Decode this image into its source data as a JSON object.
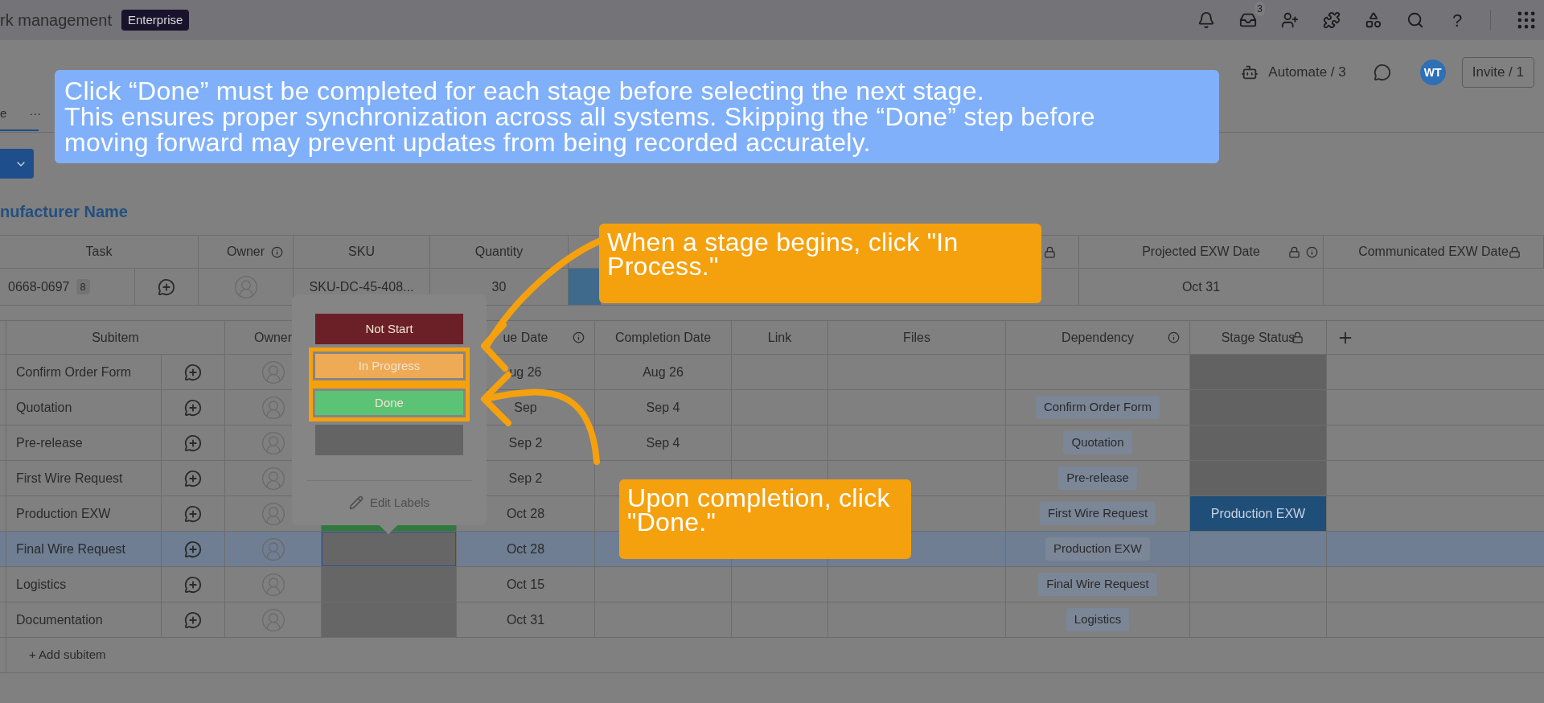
{
  "topbar": {
    "product": "rk management",
    "plan": "Enterprise",
    "inbox_count": "3",
    "help": "?"
  },
  "board": {
    "tab": "e",
    "more": "···",
    "automate": "Automate / 3",
    "avatar": "WT",
    "invite": "Invite / 1"
  },
  "group_title": "nufacturer Name",
  "main_columns": [
    {
      "label": "Task"
    },
    {
      "label": "Owner",
      "info": true
    },
    {
      "label": "SKU"
    },
    {
      "label": "Quantity"
    },
    {
      "lock": true
    },
    {
      "label": "Projected EXW Date",
      "info": true,
      "lock": true
    },
    {
      "label": "Communicated EXW Date",
      "lock": true
    }
  ],
  "main_row": {
    "task": "0668-0697",
    "count": "8",
    "sku": "SKU-DC-45-408...",
    "quantity": "30",
    "status": {
      "color": "#3f6a8c"
    },
    "projected": "Oct 31"
  },
  "sub_columns": [
    {
      "label": "Subitem"
    },
    {
      "label": "Owner"
    },
    {
      "label": "ue Date",
      "info": true
    },
    {
      "label": "Completion Date"
    },
    {
      "label": "Link"
    },
    {
      "label": "Files"
    },
    {
      "label": "Dependency",
      "info": true
    },
    {
      "label": "Stage Status",
      "lock": true
    }
  ],
  "subitems": [
    {
      "name": "Confirm Order Form",
      "selected": false,
      "due": "ug 26",
      "completion": "Aug 26",
      "stage": {
        "color": "#626262"
      }
    },
    {
      "name": "Quotation",
      "selected": false,
      "due": "Sep",
      "completion": "Sep 4",
      "dependency": "Confirm Order Form",
      "stage": {
        "color": "#626262"
      }
    },
    {
      "name": "Pre-release",
      "selected": false,
      "due": "Sep 2",
      "completion": "Sep 4",
      "dependency": "Quotation",
      "stage": {
        "color": "#626262"
      }
    },
    {
      "name": "First Wire Request",
      "selected": false,
      "due": "Sep 2",
      "dependency": "Pre-release",
      "stage": {
        "color": "#626262"
      }
    },
    {
      "name": "Production EXW",
      "selected": false,
      "due": "Oct 28",
      "status": {
        "color": "#2e7a3c"
      },
      "dependency": "First Wire Request",
      "stage": {
        "color": "#1f4e79",
        "label": "Production EXW"
      }
    },
    {
      "name": "Final Wire Request",
      "selected": true,
      "due": "Oct 28",
      "status": {
        "color": "#666666"
      },
      "dependency": "Production EXW"
    },
    {
      "name": "Logistics",
      "selected": false,
      "due": "Oct 15",
      "status": {
        "color": "#666666"
      },
      "dependency": "Final Wire Request"
    },
    {
      "name": "Documentation",
      "selected": false,
      "due": "Oct 31",
      "status": {
        "color": "#666666"
      },
      "dependency": "Logistics"
    }
  ],
  "add_subitem": "+ Add subitem",
  "status_menu": {
    "options": [
      {
        "label": "Not Start",
        "color": "#6b2028",
        "highlighted": false
      },
      {
        "label": "In Progress",
        "color": "#eeaa55",
        "highlighted": true
      },
      {
        "label": "Done",
        "color": "#5bc376",
        "highlighted": true
      },
      {
        "color": "#646464",
        "highlighted": false
      }
    ],
    "edit": "Edit Labels"
  },
  "tip": [
    "Click “Done” must be completed for each stage before selecting the next stage.",
    "This ensures proper synchronization across all systems. Skipping the “Done” step before",
    "moving forward may prevent updates from being recorded accurately."
  ],
  "callouts": [
    {
      "lines": [
        "When a stage begins, click \"In",
        "Process.\""
      ]
    },
    {
      "lines": [
        "Upon completion, click",
        "\"Done.\""
      ]
    }
  ]
}
